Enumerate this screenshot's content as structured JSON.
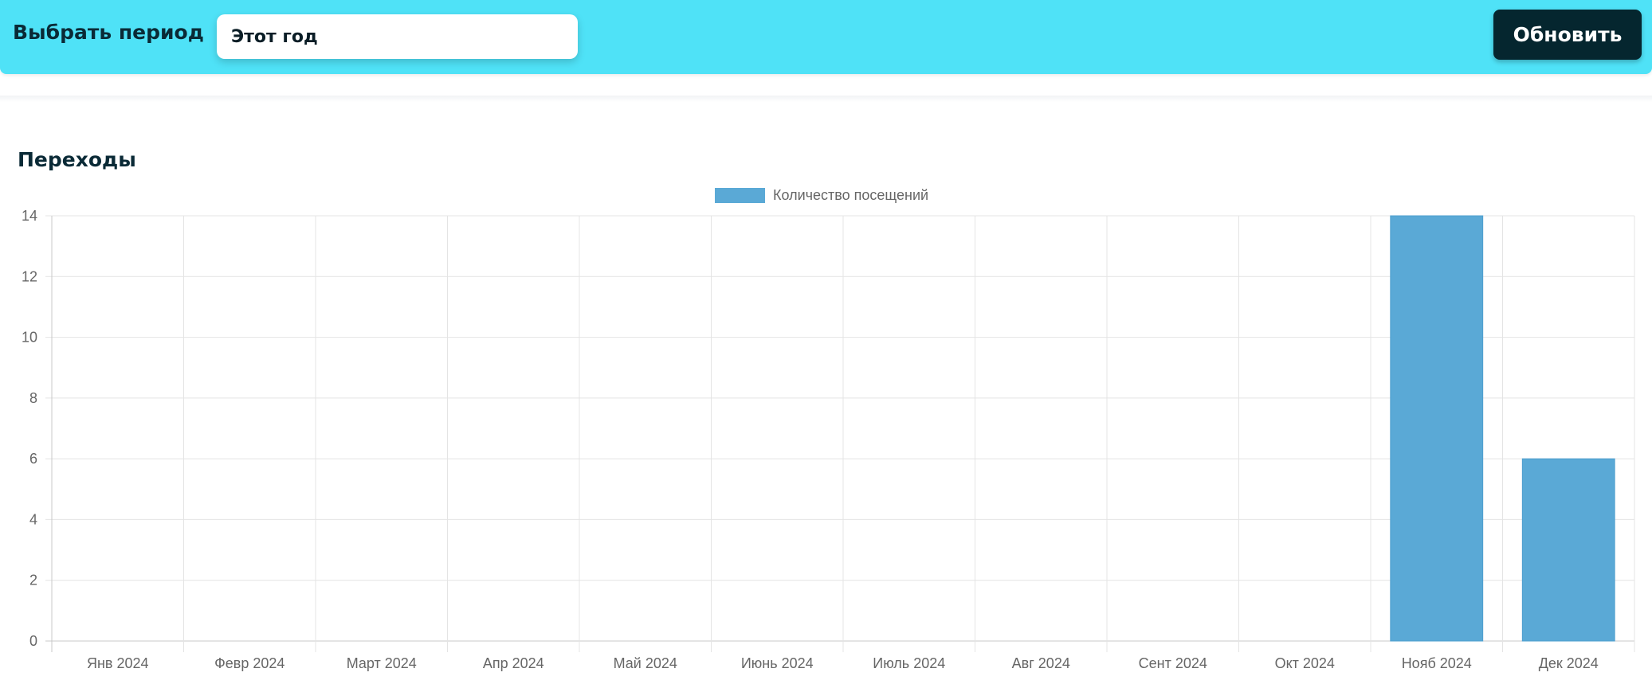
{
  "toolbar": {
    "period_label": "Выбрать период",
    "period_value": "Этот год",
    "refresh_label": "Обновить"
  },
  "section": {
    "title": "Переходы"
  },
  "colors": {
    "topbar": "#4fe2f7",
    "button": "#05262f",
    "bar": "#5aa9d6"
  },
  "chart_data": {
    "type": "bar",
    "title": "",
    "xlabel": "",
    "ylabel": "",
    "categories": [
      "Янв 2024",
      "Февр 2024",
      "Март 2024",
      "Апр 2024",
      "Май 2024",
      "Июнь 2024",
      "Июль 2024",
      "Авг 2024",
      "Сент 2024",
      "Окт 2024",
      "Нояб 2024",
      "Дек 2024"
    ],
    "series": [
      {
        "name": "Количество посещений",
        "values": [
          0,
          0,
          0,
          0,
          0,
          0,
          0,
          0,
          0,
          0,
          14,
          6
        ],
        "color": "#5aa9d6"
      }
    ],
    "ylim": [
      0,
      14
    ],
    "yticks": [
      0,
      2,
      4,
      6,
      8,
      10,
      12,
      14
    ],
    "grid": true,
    "legend": "top-center"
  }
}
